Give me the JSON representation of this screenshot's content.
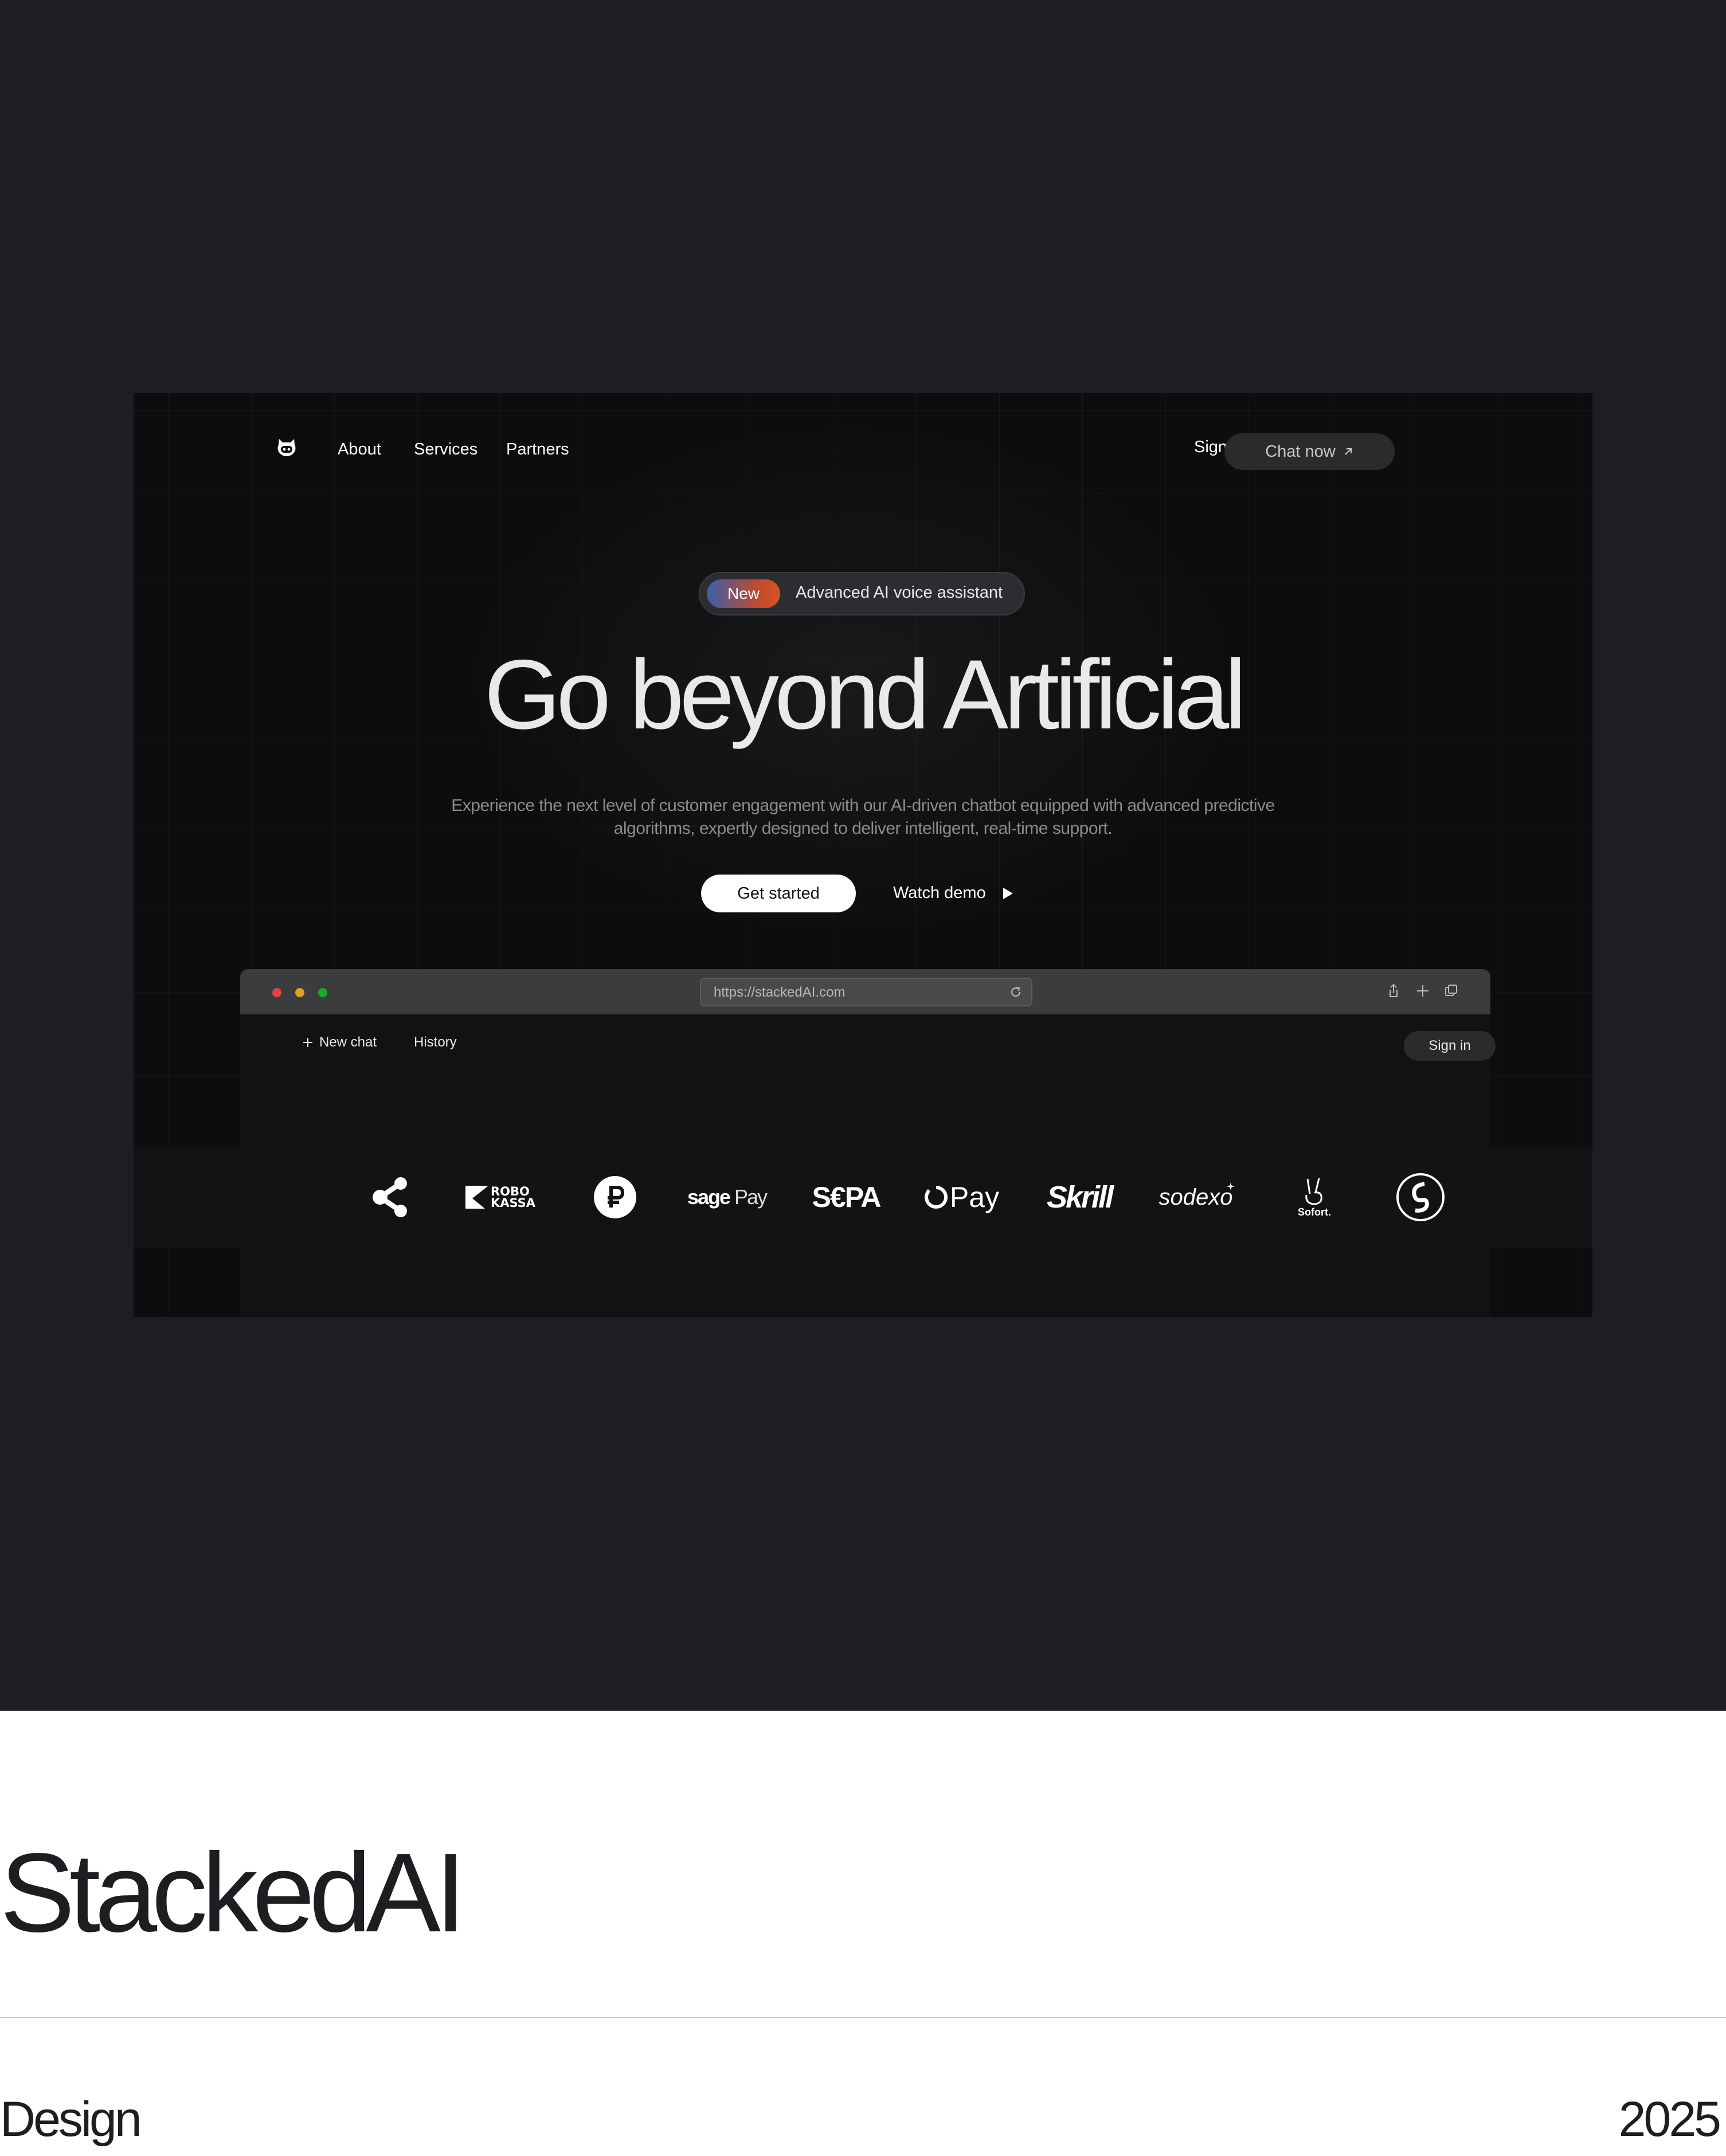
{
  "nav": {
    "links": [
      "About",
      "Services",
      "Partners"
    ],
    "sign_in": "Sign in",
    "cta": "Chat now"
  },
  "badge": {
    "tag": "New",
    "text": "Advanced AI voice assistant"
  },
  "hero": {
    "title": "Go beyond Artificial",
    "subtitle": "Experience the next level of customer engagement with our AI-driven chatbot equipped with advanced predictive algorithms, expertly designed to deliver intelligent, real-time support.",
    "primary_button": "Get started",
    "secondary_button": "Watch demo"
  },
  "browser": {
    "url": "https://stackedAI.com",
    "new_chat": "New chat",
    "history": "History",
    "sign_in": "Sign in"
  },
  "partners": {
    "robokassa_line1": "ROBO",
    "robokassa_line2": "KASSA",
    "sage_a": "sage",
    "sage_b": "Pay",
    "sepa": "S€PA",
    "opay": "Pay",
    "skrill": "Skrill",
    "sodexo": "sodexo",
    "sofort": "Sofort."
  },
  "footer": {
    "brand": "StackedAI",
    "category": "Design",
    "year": "2025"
  },
  "colors": {
    "outer_background": "#1d1e21",
    "frame_background": "#0c0d0e",
    "badge_gradient_start": "#3a5fa8",
    "badge_gradient_end": "#d65224",
    "traffic_red": "#e0443e",
    "traffic_yellow": "#dea123",
    "traffic_green": "#1aab29"
  }
}
